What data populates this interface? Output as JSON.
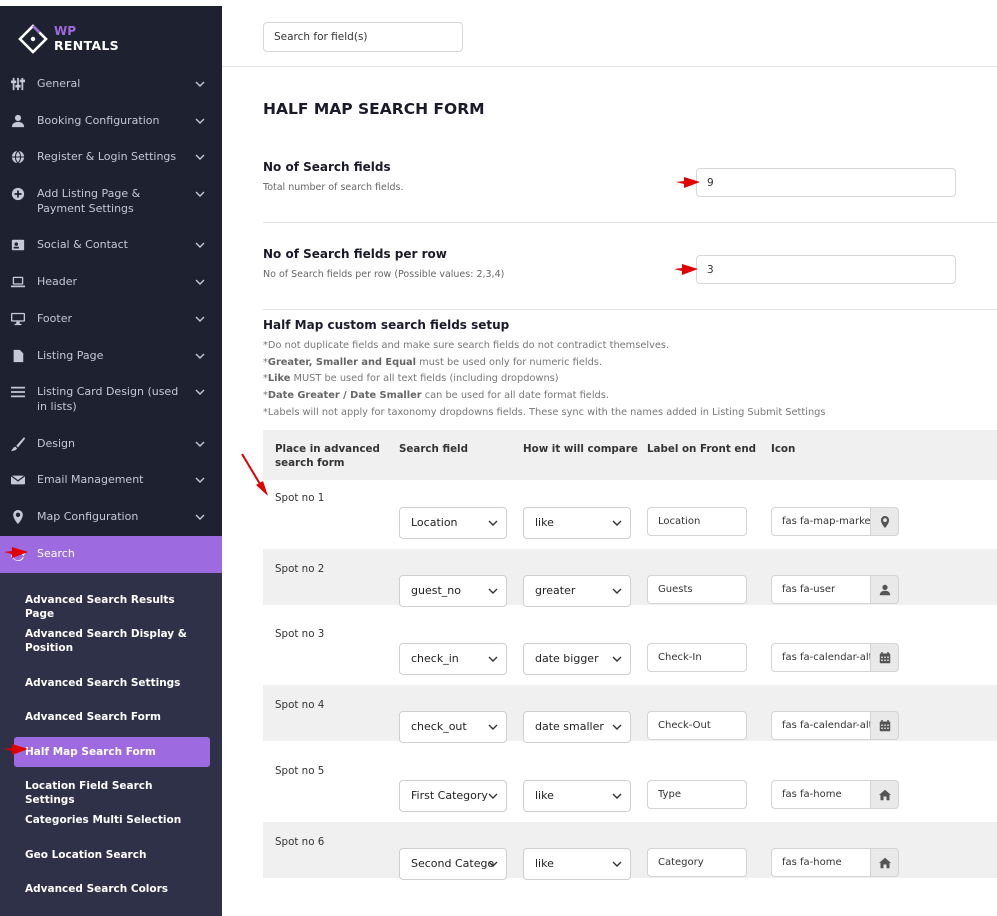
{
  "brand": {
    "line1": "WP",
    "line2": "RENTALS"
  },
  "sidebar": {
    "items": [
      {
        "label": "General",
        "icon": "sliders-icon"
      },
      {
        "label": "Booking Configuration",
        "icon": "user-icon"
      },
      {
        "label": "Register & Login Settings",
        "icon": "globe-icon"
      },
      {
        "label": "Add Listing Page & Payment Settings",
        "icon": "plus-circle-icon"
      },
      {
        "label": "Social & Contact",
        "icon": "contact-card-icon"
      },
      {
        "label": "Header",
        "icon": "laptop-icon"
      },
      {
        "label": "Footer",
        "icon": "desktop-icon"
      },
      {
        "label": "Listing Page",
        "icon": "file-icon"
      },
      {
        "label": "Listing Card Design (used in lists)",
        "icon": "list-icon"
      },
      {
        "label": "Design",
        "icon": "brush-icon"
      },
      {
        "label": "Email Management",
        "icon": "envelope-icon"
      },
      {
        "label": "Map Configuration",
        "icon": "map-marker-icon"
      }
    ],
    "active": {
      "label": "Search",
      "icon": "sync-icon"
    },
    "submenu": [
      "Advanced Search Results Page",
      "Advanced Search Display & Position",
      "Advanced Search Settings",
      "Advanced Search Form",
      "Half Map Search Form",
      "Location Field Search Settings",
      "Categories Multi Selection",
      "Geo Location Search",
      "Advanced Search Colors"
    ]
  },
  "search": {
    "placeholder": "Search for field(s)"
  },
  "page_title": "HALF MAP SEARCH FORM",
  "fields": {
    "num_fields": {
      "title": "No of Search fields",
      "desc": "Total number of search fields.",
      "value": "9"
    },
    "per_row": {
      "title": "No of Search fields per row",
      "desc": "No of Search fields per row (Possible values: 2,3,4)",
      "value": "3"
    }
  },
  "custom": {
    "title": "Half Map custom search fields setup",
    "notes": [
      {
        "pre": "*Do not duplicate fields and make sure search fields do not contradict themselves.",
        "bold": "",
        "post": ""
      },
      {
        "pre": "*",
        "bold": "Greater, Smaller and Equal",
        "post": " must be used only for numeric fields."
      },
      {
        "pre": "*",
        "bold": "Like",
        "post": " MUST be used for all text fields (including dropdowns)"
      },
      {
        "pre": "*",
        "bold": "Date Greater / Date Smaller",
        "post": " can be used for all date format fields."
      },
      {
        "pre": "*Labels will not apply for taxonomy dropdowns fields. These sync with the names added in Listing Submit Settings",
        "bold": "",
        "post": ""
      }
    ]
  },
  "table": {
    "headers": [
      "Place in advanced search form",
      "Search field",
      "How it will compare",
      "Label on Front end",
      "Icon"
    ],
    "rows": [
      {
        "spot": "Spot no 1",
        "field": "Location",
        "compare": "like",
        "label": "Location",
        "icon_text": "fas fa-map-marker",
        "icon": "map-marker-icon"
      },
      {
        "spot": "Spot no 2",
        "field": "guest_no",
        "compare": "greater",
        "label": "Guests",
        "icon_text": "fas fa-user",
        "icon": "user-icon"
      },
      {
        "spot": "Spot no 3",
        "field": "check_in",
        "compare": "date bigger",
        "label": "Check-In",
        "icon_text": "fas fa-calendar-alt",
        "icon": "calendar-icon"
      },
      {
        "spot": "Spot no 4",
        "field": "check_out",
        "compare": "date smaller",
        "label": "Check-Out",
        "icon_text": "fas fa-calendar-alt",
        "icon": "calendar-icon"
      },
      {
        "spot": "Spot no 5",
        "field": "First Category",
        "compare": "like",
        "label": "Type",
        "icon_text": "fas fa-home",
        "icon": "home-icon"
      },
      {
        "spot": "Spot no 6",
        "field": "Second Category",
        "compare": "like",
        "label": "Category",
        "icon_text": "fas fa-home",
        "icon": "home-icon"
      }
    ]
  },
  "colors": {
    "accent": "#9d6ae0",
    "sidebar_bg": "#1e2130",
    "submenu_bg": "#2e3147",
    "annotation_red": "#e00000"
  }
}
